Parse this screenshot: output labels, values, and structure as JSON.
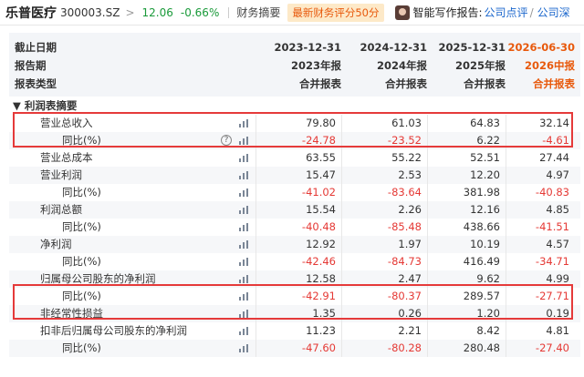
{
  "topbar": {
    "stock_name": "乐普医疗",
    "stock_code": "300003.SZ",
    "chevron": ">",
    "price": "12.06",
    "change_pct": "-0.66%",
    "tab_label": "财务摘要",
    "badge_text": "最新财务评分50分",
    "ai_label": "智能写作报告:",
    "link1": "公司点评",
    "slash": "/",
    "link2": "公司深"
  },
  "header": {
    "labels": [
      "截止日期",
      "报告期",
      "报表类型"
    ],
    "columns": [
      {
        "date": "2023-12-31",
        "period": "2023年报",
        "type": "合并报表"
      },
      {
        "date": "2024-12-31",
        "period": "2024年报",
        "type": "合并报表"
      },
      {
        "date": "2025-12-31",
        "period": "2025年报",
        "type": "合并报表"
      },
      {
        "date": "2026-06-30",
        "period": "2026中报",
        "type": "合并报表"
      }
    ]
  },
  "section_title": "▼ 利润表摘要",
  "rows": [
    {
      "label": "营业总收入",
      "sub": false,
      "help": false,
      "values": [
        "79.80",
        "61.03",
        "64.83",
        "32.14"
      ]
    },
    {
      "label": "同比(%)",
      "sub": true,
      "help": true,
      "values": [
        "-24.78",
        "-23.52",
        "6.22",
        "-4.61"
      ]
    },
    {
      "label": "营业总成本",
      "sub": false,
      "help": false,
      "values": [
        "63.55",
        "55.22",
        "52.51",
        "27.44"
      ]
    },
    {
      "label": "营业利润",
      "sub": false,
      "help": false,
      "values": [
        "15.47",
        "2.53",
        "12.20",
        "4.97"
      ]
    },
    {
      "label": "同比(%)",
      "sub": true,
      "help": false,
      "values": [
        "-41.02",
        "-83.64",
        "381.98",
        "-40.83"
      ]
    },
    {
      "label": "利润总额",
      "sub": false,
      "help": false,
      "values": [
        "15.54",
        "2.26",
        "12.16",
        "4.85"
      ]
    },
    {
      "label": "同比(%)",
      "sub": true,
      "help": false,
      "values": [
        "-40.48",
        "-85.48",
        "438.66",
        "-41.51"
      ]
    },
    {
      "label": "净利润",
      "sub": false,
      "help": false,
      "values": [
        "12.92",
        "1.97",
        "10.19",
        "4.57"
      ]
    },
    {
      "label": "同比(%)",
      "sub": true,
      "help": false,
      "values": [
        "-42.46",
        "-84.73",
        "416.49",
        "-34.71"
      ]
    },
    {
      "label": "归属母公司股东的净利润",
      "sub": false,
      "help": false,
      "values": [
        "12.58",
        "2.47",
        "9.62",
        "4.99"
      ]
    },
    {
      "label": "同比(%)",
      "sub": true,
      "help": false,
      "values": [
        "-42.91",
        "-80.37",
        "289.57",
        "-27.71"
      ]
    },
    {
      "label": "非经常性损益",
      "sub": false,
      "help": false,
      "values": [
        "1.35",
        "0.26",
        "1.20",
        "0.19"
      ]
    },
    {
      "label": "扣非后归属母公司股东的净利润",
      "sub": false,
      "help": false,
      "values": [
        "11.23",
        "2.21",
        "8.42",
        "4.81"
      ]
    },
    {
      "label": "同比(%)",
      "sub": true,
      "help": false,
      "values": [
        "-47.60",
        "-80.28",
        "280.48",
        "-27.40"
      ]
    }
  ],
  "help_icon_text": "?",
  "colors": {
    "negative": "#e53935",
    "accent": "#e8590c",
    "up_green": "#1a9a3a",
    "highlight_box": "#e53a3a"
  }
}
